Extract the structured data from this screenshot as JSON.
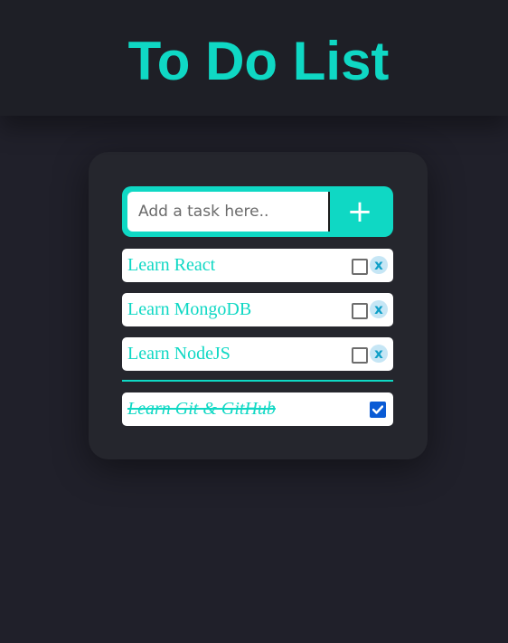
{
  "header": {
    "title": "To Do List"
  },
  "form": {
    "placeholder": "Add a task here..",
    "add_label": "+"
  },
  "tasks": {
    "pending": [
      {
        "label": "Learn React",
        "checked": false,
        "delete_label": "x"
      },
      {
        "label": "Learn MongoDB",
        "checked": false,
        "delete_label": "x"
      },
      {
        "label": "Learn NodeJS",
        "checked": false,
        "delete_label": "x"
      }
    ],
    "completed": [
      {
        "label": "Learn Git & GitHub",
        "checked": true
      }
    ]
  },
  "colors": {
    "accent": "#0fd8c4",
    "background": "#20202a",
    "header_bg": "#1e1f26",
    "card_bg": "#25262d",
    "checkbox_checked": "#0a5bd5"
  },
  "icons": {
    "add": "plus-icon",
    "delete": "close-icon",
    "check": "checkmark-icon"
  }
}
